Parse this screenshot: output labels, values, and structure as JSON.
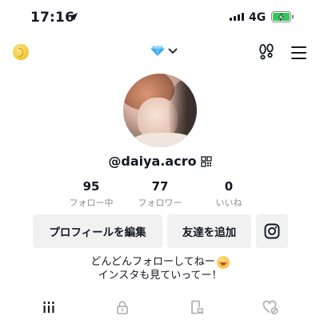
{
  "status_bar": {
    "time": "17:16",
    "network": "4G",
    "icons": [
      "location-arrow-icon",
      "signal-icon",
      "battery-charging-icon"
    ]
  },
  "top_nav": {
    "left_icon": "coin-icon",
    "center_icon": "diamond-icon",
    "center_dropdown_icon": "chevron-down-icon",
    "right_icons": [
      "footprint-icon",
      "menu-icon"
    ],
    "accent_color": "#3aa8f0"
  },
  "profile": {
    "username": "@daiya.acro",
    "username_icon": "qr-code-icon",
    "stats": [
      {
        "value": "95",
        "label": "フォロー中"
      },
      {
        "value": "77",
        "label": "フォロワー"
      },
      {
        "value": "0",
        "label": "いいね"
      }
    ]
  },
  "actions": {
    "edit_profile": "プロフィールを編集",
    "add_friends": "友達を追加",
    "instagram_icon": "instagram-icon"
  },
  "bio": {
    "line1": "どんどんフォローしてねー",
    "line1_emoji": "grinning-face-emoji",
    "line2": "インスタも見ていってー！"
  },
  "tabs": [
    {
      "icon": "grid-icon",
      "selected": true
    },
    {
      "icon": "lock-icon",
      "selected": false
    },
    {
      "icon": "saved-icon",
      "selected": false
    },
    {
      "icon": "liked-icon",
      "selected": false
    }
  ],
  "colors": {
    "text": "#161823",
    "secondary_text": "#8a8b91",
    "button_bg": "#f1f1f2",
    "battery_green": "#34c759"
  }
}
